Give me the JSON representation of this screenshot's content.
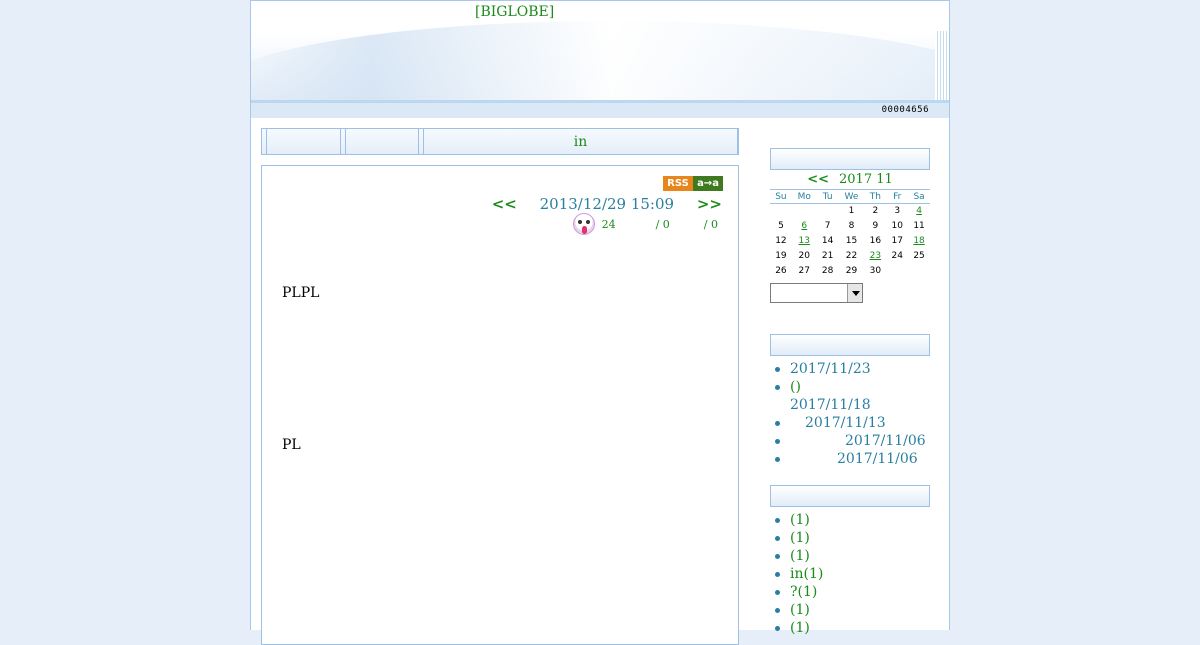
{
  "header": {
    "site_title": "[BIGLOBE]",
    "counter": "00004656"
  },
  "nav": {
    "tabs": [
      "",
      "",
      "in"
    ]
  },
  "article": {
    "prev": "<<",
    "date": "2013/12/29 15:09",
    "next": ">>",
    "meta": {
      "count_a": "24",
      "count_b": "/ 0",
      "count_c": "/ 0"
    },
    "paragraphs": [
      "PLPL",
      "PL"
    ],
    "rss_label": "RSS",
    "a2a_label": "a→a"
  },
  "calendar": {
    "prev": "<<",
    "title": "2017 11",
    "weekdays": [
      "Su",
      "Mo",
      "Tu",
      "We",
      "Th",
      "Fr",
      "Sa"
    ],
    "weeks": [
      [
        "",
        "",
        "",
        "1",
        "2",
        "3",
        "4"
      ],
      [
        "5",
        "6",
        "7",
        "8",
        "9",
        "10",
        "11"
      ],
      [
        "12",
        "13",
        "14",
        "15",
        "16",
        "17",
        "18"
      ],
      [
        "19",
        "20",
        "21",
        "22",
        "23",
        "24",
        "25"
      ],
      [
        "26",
        "27",
        "28",
        "29",
        "30",
        "",
        ""
      ]
    ],
    "linked_days": [
      "4",
      "6",
      "13",
      "18",
      "23"
    ],
    "select_value": ""
  },
  "recent": [
    {
      "title": "",
      "date": "2017/11/23"
    },
    {
      "title": "()",
      "date": "2017/11/18"
    },
    {
      "title": "",
      "date": "2017/11/13"
    },
    {
      "title": "",
      "date": "2017/11/06"
    },
    {
      "title": "",
      "date": "2017/11/06"
    }
  ],
  "categories": [
    "(1)",
    "(1)",
    "(1)",
    "in(1)",
    "?(1)",
    " (1)",
    "(1)"
  ]
}
